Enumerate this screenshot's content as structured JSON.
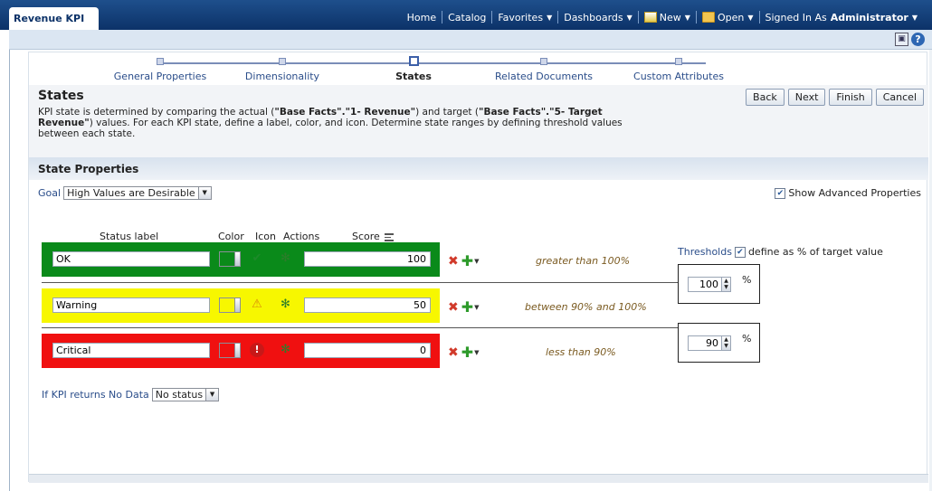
{
  "app": {
    "tab_title": "Revenue KPI"
  },
  "global_nav": {
    "home": "Home",
    "catalog": "Catalog",
    "favorites": "Favorites",
    "dashboards": "Dashboards",
    "new": "New",
    "open": "Open",
    "signed_in_as": "Signed In As",
    "user": "Administrator"
  },
  "train": {
    "steps": [
      "General Properties",
      "Dimensionality",
      "States",
      "Related Documents",
      "Custom Attributes"
    ],
    "current": "States"
  },
  "page": {
    "title": "States",
    "desc_1": "KPI state is determined by comparing the actual (",
    "actual_measure": "\"Base Facts\".\"1- Revenue\"",
    "desc_2": ") and target (",
    "target_measure": "\"Base Facts\".\"5- Target Revenue\"",
    "desc_3": ") values. For each KPI state, define a label, color, and icon. Determine state ranges by defining threshold values between each state."
  },
  "buttons": {
    "back": "Back",
    "next": "Next",
    "finish": "Finish",
    "cancel": "Cancel"
  },
  "state_properties": {
    "title": "State Properties",
    "goal_label": "Goal",
    "goal_value": "High Values are Desirable",
    "show_advanced": "Show Advanced Properties",
    "show_advanced_checked": true
  },
  "columns": {
    "status_label": "Status label",
    "color": "Color",
    "icon": "Icon",
    "actions": "Actions",
    "score": "Score"
  },
  "states": [
    {
      "label": "OK",
      "score": "100",
      "color": "#0a8a1a",
      "icon": "check-icon",
      "range": "greater than 100%"
    },
    {
      "label": "Warning",
      "score": "50",
      "color": "#f7f700",
      "icon": "warning-icon",
      "range": "between 90% and 100%"
    },
    {
      "label": "Critical",
      "score": "0",
      "color": "#f01010",
      "icon": "error-icon",
      "range": "less than 90%"
    }
  ],
  "thresholds": {
    "label": "Thresholds",
    "define_pct": "define as % of target value",
    "define_pct_checked": true,
    "values": [
      "100",
      "90"
    ],
    "unit": "%"
  },
  "no_data": {
    "label": "If KPI returns No Data",
    "value": "No status"
  }
}
